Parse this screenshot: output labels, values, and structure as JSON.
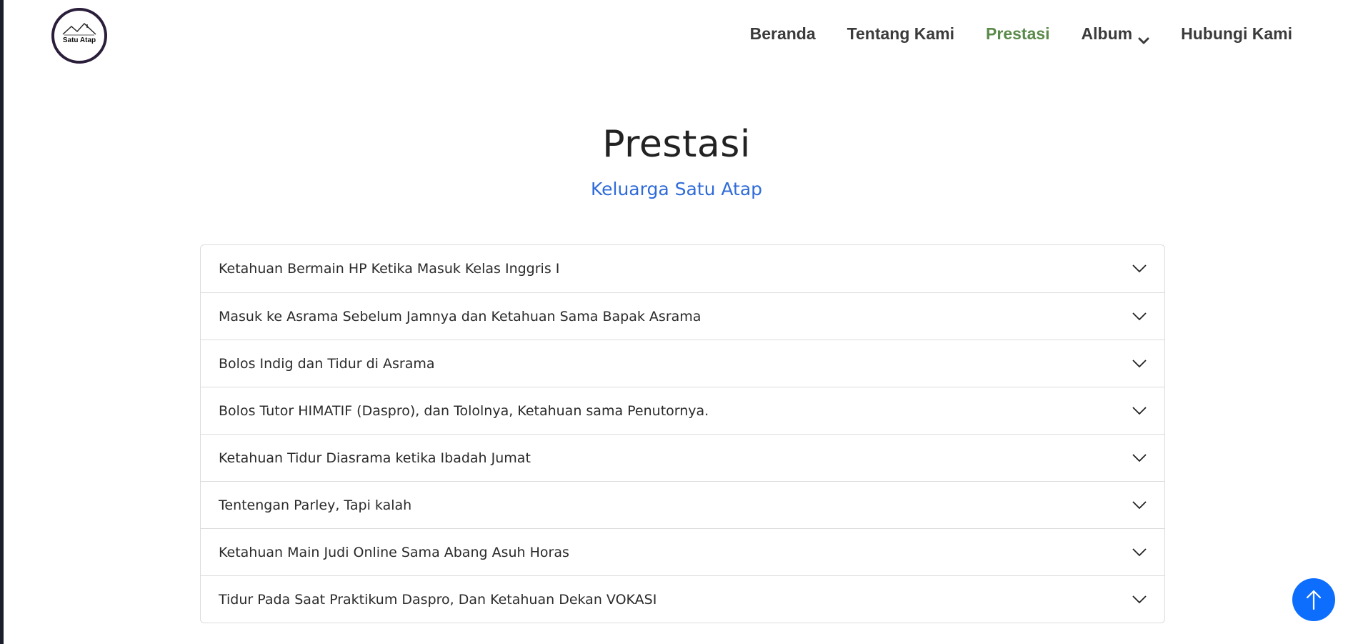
{
  "brand": {
    "logo_text": "Satu Atap"
  },
  "nav": {
    "items": [
      {
        "label": "Beranda",
        "active": false
      },
      {
        "label": "Tentang Kami",
        "active": false
      },
      {
        "label": "Prestasi",
        "active": true
      },
      {
        "label": "Album",
        "active": false,
        "has_dropdown": true
      },
      {
        "label": "Hubungi Kami",
        "active": false
      }
    ]
  },
  "section": {
    "title": "Prestasi",
    "subtitle": "Keluarga Satu Atap"
  },
  "accordion": {
    "items": [
      {
        "label": "Ketahuan Bermain HP Ketika Masuk Kelas Inggris I"
      },
      {
        "label": "Masuk ke Asrama Sebelum Jamnya dan Ketahuan Sama Bapak Asrama"
      },
      {
        "label": "Bolos Indig dan Tidur di Asrama"
      },
      {
        "label": "Bolos Tutor HIMATIF (Daspro), dan Tololnya, Ketahuan sama Penutornya."
      },
      {
        "label": "Ketahuan Tidur Diasrama ketika Ibadah Jumat"
      },
      {
        "label": "Tentengan Parley, Tapi kalah"
      },
      {
        "label": "Ketahuan Main Judi Online Sama Abang Asuh Horas"
      },
      {
        "label": "Tidur Pada Saat Praktikum Daspro, Dan Ketahuan Dekan VOKASI"
      }
    ]
  },
  "icons": {
    "accordion_toggle": "chevron-down-icon",
    "back_to_top": "arrow-up-icon",
    "logo_graphic": "house-roof-icon"
  },
  "colors": {
    "nav_active": "#5a8a4a",
    "nav_default": "#3b3b3b",
    "subtitle": "#2f6bd8",
    "back_to_top": "#0d6efd"
  }
}
